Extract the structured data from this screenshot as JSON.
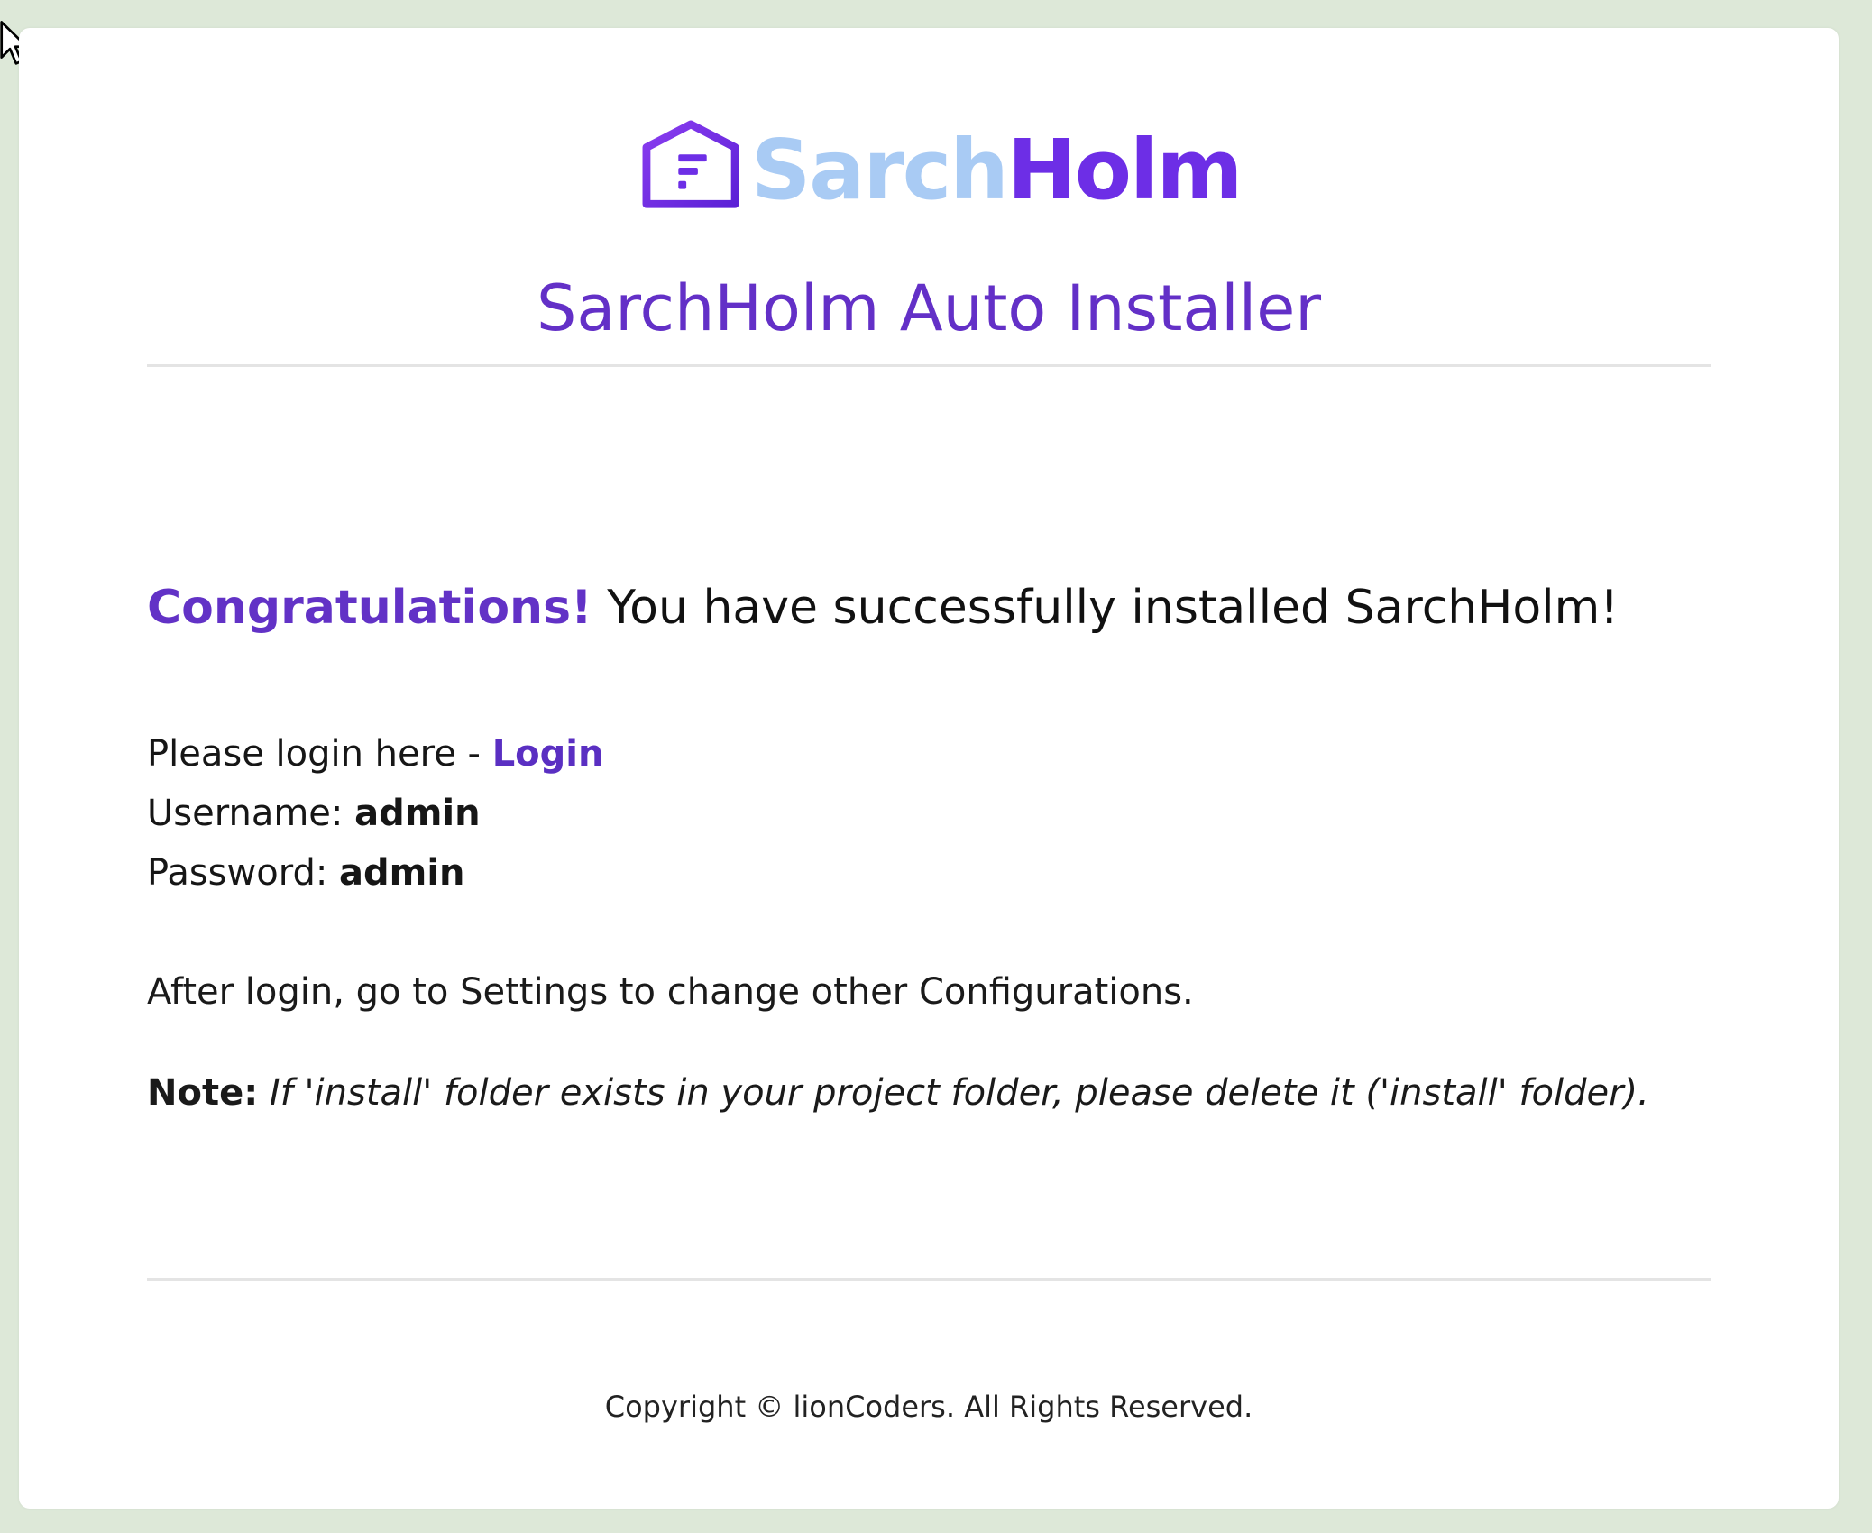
{
  "logo": {
    "name_part1": "Sarch",
    "name_part2": "Holm",
    "icon": "house-logo-icon",
    "colors": {
      "part1": "#a9cbf4",
      "part2": "#6d2ee6"
    }
  },
  "header": {
    "title": "SarchHolm Auto Installer"
  },
  "main": {
    "congrats": "Congratulations!",
    "headline_rest": " You have successfully installed SarchHolm!",
    "login_prompt": "Please login here - ",
    "login_link": "Login",
    "username_label": "Username: ",
    "username_value": "admin",
    "password_label": "Password: ",
    "password_value": "admin",
    "after_login": "After login, go to Settings to change other Configurations.",
    "note_label": "Note:",
    "note_text": " If 'install' folder exists in your project folder, please delete it ('install' folder)."
  },
  "footer": {
    "copyright": "Copyright © lionCoders. All Rights Reserved."
  },
  "colors": {
    "accent": "#6232c6",
    "page_background": "#dde8d8",
    "card_background": "#ffffff"
  }
}
